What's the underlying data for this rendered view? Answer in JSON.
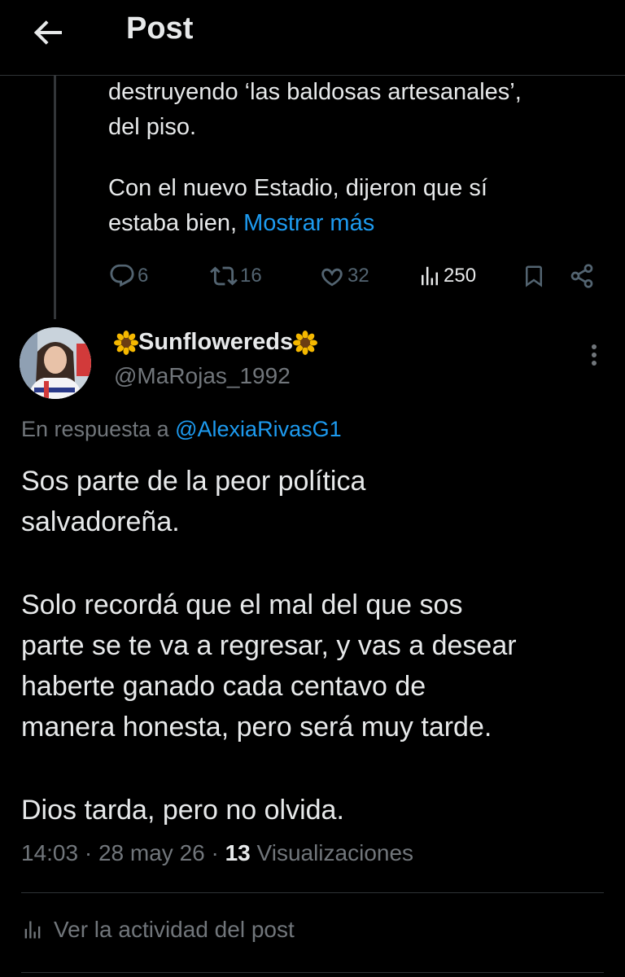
{
  "header": {
    "title": "Post",
    "back_icon": "arrow-left-icon"
  },
  "parent_post": {
    "lines": [
      "destruyendo ‘las baldosas artesanales’,",
      "del piso."
    ],
    "lines2": [
      "Con el nuevo Estadio, dijeron que sí",
      "estaba bien, "
    ],
    "show_more": "Mostrar más",
    "actions": {
      "replies": "6",
      "reposts": "16",
      "likes": "32",
      "views": "250"
    }
  },
  "reply_post": {
    "display_name": "Sunflowereds",
    "handle": "@MaRojas_1992",
    "reply_to_prefix": "En respuesta a ",
    "reply_to_handle": "@AlexiaRivasG1",
    "paragraphs": [
      [
        "Sos parte de la peor política",
        "salvadoreña."
      ],
      [
        "Solo recordá que el mal del que sos",
        "parte se te va a regresar, y vas a desear",
        "haberte ganado cada centavo de",
        "manera honesta, pero será muy tarde."
      ],
      [
        "Dios tarda, pero no olvida."
      ]
    ],
    "time": "14:03",
    "date": "28 may 26",
    "view_count": "13",
    "views_label": "Visualizaciones",
    "activity_label": "Ver la actividad del post"
  },
  "colors": {
    "background": "#000000",
    "text": "#e7e9ea",
    "muted": "#71767b",
    "link": "#1d9bf0",
    "divider": "#2f3336"
  }
}
